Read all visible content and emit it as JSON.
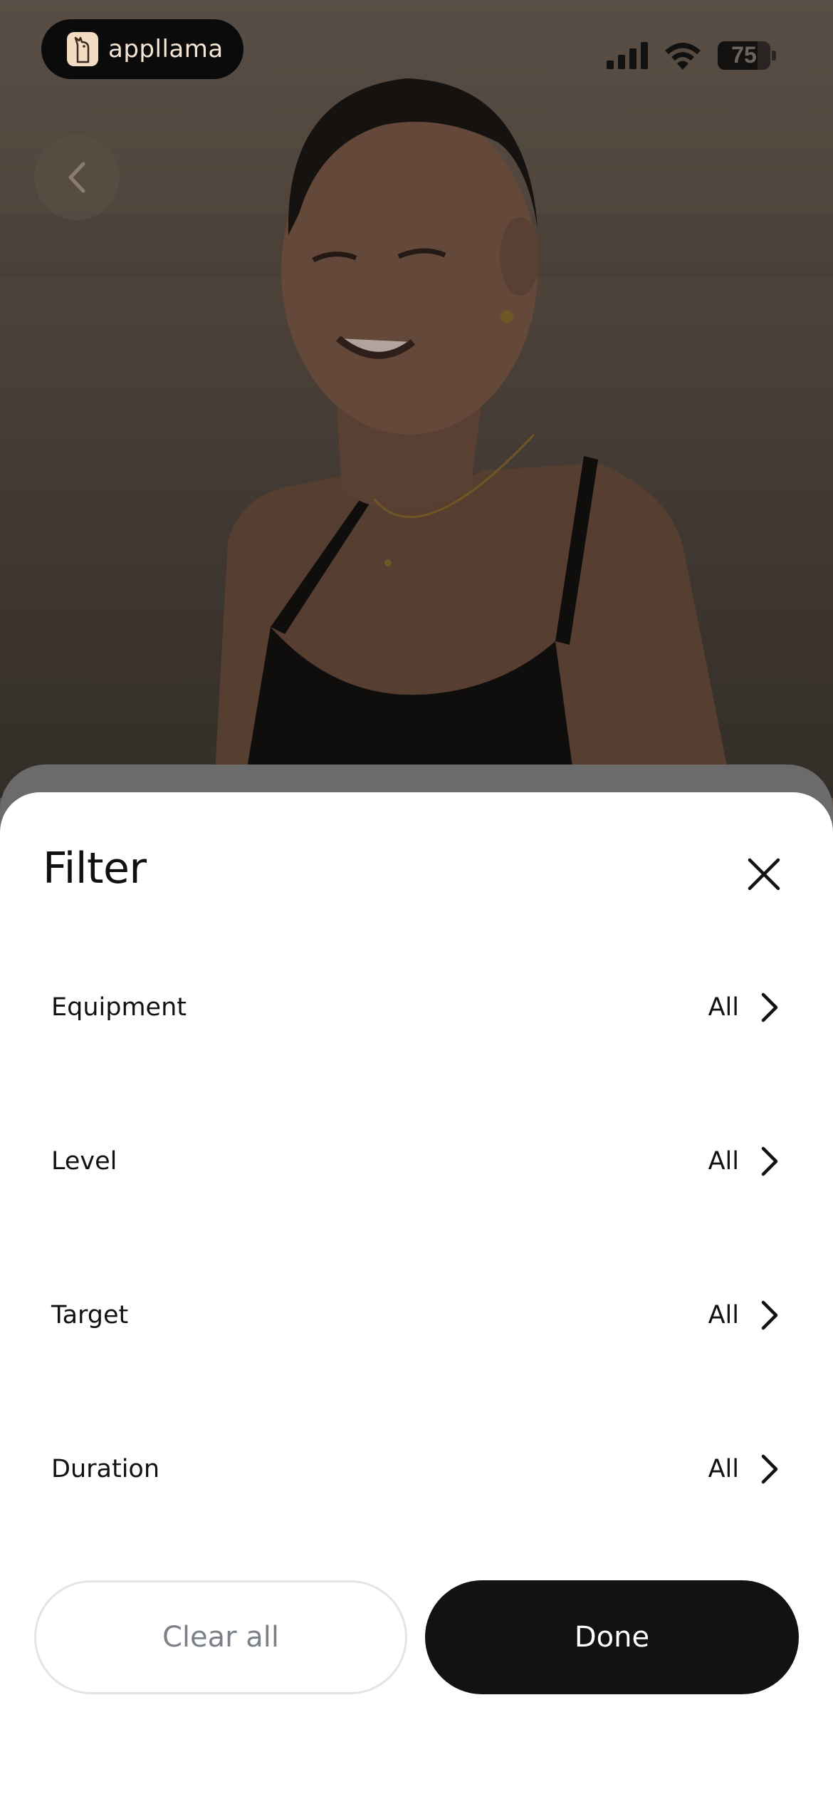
{
  "status_bar": {
    "app_name": "appllama",
    "battery_level": "75",
    "battery_fraction": 0.75,
    "icons": [
      "llama-logo-icon",
      "cellular-signal-icon",
      "wifi-icon",
      "battery-icon"
    ]
  },
  "navigation": {
    "back_icon": "chevron-left-icon"
  },
  "sheet": {
    "title": "Filter",
    "close_icon": "close-icon",
    "filters": [
      {
        "label": "Equipment",
        "value": "All",
        "icon": "chevron-right-icon"
      },
      {
        "label": "Level",
        "value": "All",
        "icon": "chevron-right-icon"
      },
      {
        "label": "Target",
        "value": "All",
        "icon": "chevron-right-icon"
      },
      {
        "label": "Duration",
        "value": "All",
        "icon": "chevron-right-icon"
      }
    ],
    "clear_label": "Clear all",
    "done_label": "Done"
  },
  "colors": {
    "sheet_bg": "#ffffff",
    "done_bg": "#111214",
    "clear_text": "#7c8088",
    "overlay": "#6b6b6b"
  }
}
